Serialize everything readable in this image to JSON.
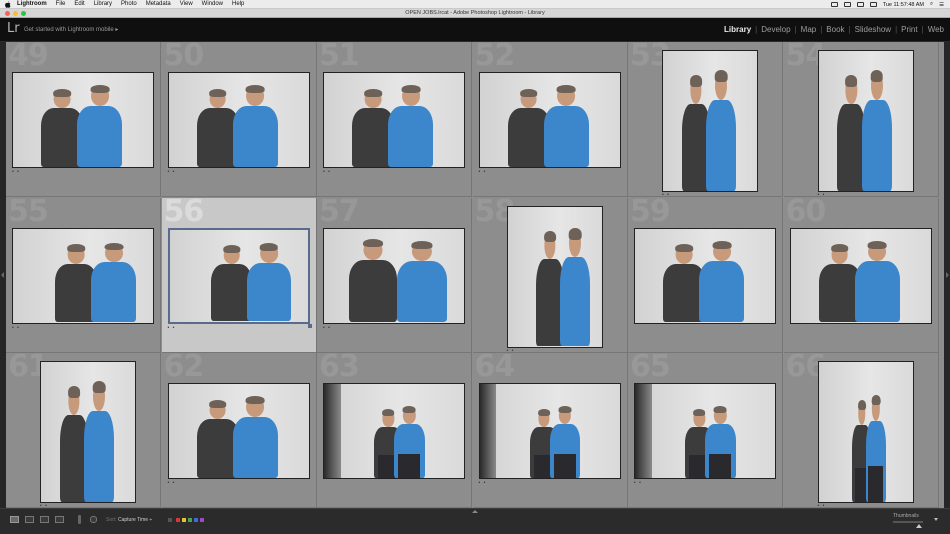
{
  "menubar": {
    "app": "Lightroom",
    "items": [
      "File",
      "Edit",
      "Library",
      "Photo",
      "Metadata",
      "View",
      "Window",
      "Help"
    ],
    "clock": "Tue 11:57:48 AM"
  },
  "window": {
    "title": "OPEN JOBS.lrcat - Adobe Photoshop Lightroom - Library"
  },
  "header": {
    "logo": "Lr",
    "mobile_prompt": "Get started with Lightroom mobile ▸",
    "modules": [
      "Library",
      "Develop",
      "Map",
      "Book",
      "Slideshow",
      "Print",
      "Web"
    ],
    "active_module": "Library"
  },
  "grid": {
    "cells": [
      {
        "num": "49",
        "orient": "landscape",
        "stars": "• •",
        "pose": "hug"
      },
      {
        "num": "50",
        "orient": "landscape",
        "stars": "• •",
        "pose": "hug"
      },
      {
        "num": "51",
        "orient": "landscape",
        "stars": "• •",
        "pose": "hug"
      },
      {
        "num": "52",
        "orient": "landscape",
        "stars": "• •",
        "pose": "hug"
      },
      {
        "num": "53",
        "orient": "portrait",
        "stars": "• •",
        "pose": "hug"
      },
      {
        "num": "54",
        "orient": "portrait",
        "stars": "• •",
        "pose": "hug"
      },
      {
        "num": "55",
        "orient": "landscape",
        "stars": "• •",
        "pose": "side"
      },
      {
        "num": "56",
        "orient": "landscape",
        "stars": "• •",
        "pose": "side",
        "selected": true
      },
      {
        "num": "57",
        "orient": "landscape",
        "stars": "• •",
        "pose": "front"
      },
      {
        "num": "58",
        "orient": "portrait",
        "stars": "• •",
        "pose": "side"
      },
      {
        "num": "59",
        "orient": "landscape",
        "stars": "",
        "pose": "hug"
      },
      {
        "num": "60",
        "orient": "landscape",
        "stars": "",
        "pose": "hug"
      },
      {
        "num": "61",
        "orient": "portrait",
        "stars": "• •",
        "pose": "hug"
      },
      {
        "num": "62",
        "orient": "landscape",
        "stars": "• •",
        "pose": "hug"
      },
      {
        "num": "63",
        "orient": "landscape",
        "stars": "",
        "pose": "stand",
        "dark_left": true
      },
      {
        "num": "64",
        "orient": "landscape",
        "stars": "• •",
        "pose": "stand",
        "dark_left": true
      },
      {
        "num": "65",
        "orient": "landscape",
        "stars": "• •",
        "pose": "stand",
        "dark_left": true
      },
      {
        "num": "66",
        "orient": "portrait",
        "stars": "• •",
        "pose": "stand"
      }
    ]
  },
  "toolbar": {
    "sort_label": "Sort:",
    "sort_value": "Capture Time ÷",
    "thumbnails_label": "Thumbnails",
    "label_colors": [
      "#d23a3a",
      "#e3c23a",
      "#4aa34a",
      "#3a6fd2",
      "#9a4ac8"
    ]
  }
}
